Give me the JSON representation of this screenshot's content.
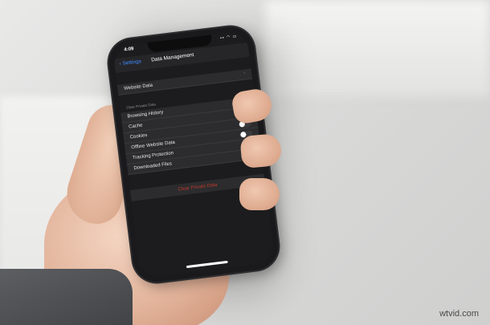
{
  "status_bar": {
    "time": "4:09",
    "icons": "▪▪ ◠ ▭"
  },
  "nav": {
    "back_label": "Settings",
    "title": "Data Management"
  },
  "website_data": {
    "label": "Website Data"
  },
  "clear_private_data": {
    "header": "Clear Private Data",
    "items": [
      {
        "label": "Browsing History",
        "on": false
      },
      {
        "label": "Cache",
        "on": true
      },
      {
        "label": "Cookies",
        "on": false
      },
      {
        "label": "Offline Website Data",
        "on": false
      },
      {
        "label": "Tracking Protection",
        "on": false
      },
      {
        "label": "Downloaded Files",
        "on": false
      }
    ]
  },
  "clear_button": {
    "label": "Clear Private Data"
  },
  "watermark": "wtvid.com",
  "colors": {
    "accent": "#2f7df6",
    "destructive": "#c0392b"
  }
}
